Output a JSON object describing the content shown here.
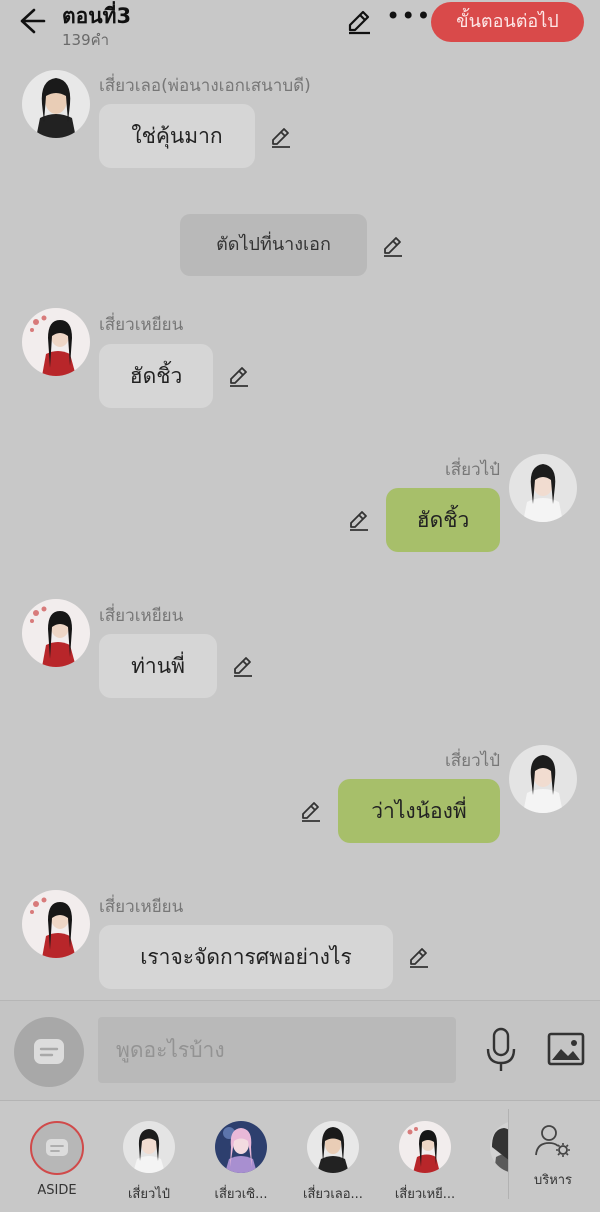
{
  "header": {
    "title": "ตอนที่3",
    "word_count": "139คำ",
    "next_step_label": "ขั้นตอนต่อไป",
    "accent_color": "#d94a4a"
  },
  "messages": [
    {
      "type": "left",
      "sender": "เสี่ยวเลอ(พ่อนางเอกเสนาบดี)",
      "text": "ใช่คุ้นมาก",
      "avatar": "male-black-robe"
    },
    {
      "type": "narration",
      "text": "ตัดไปที่นางเอก"
    },
    {
      "type": "left",
      "sender": "เสี่ยวเหยียน",
      "text": "ฮัดชิ้ว",
      "avatar": "female-red-dress"
    },
    {
      "type": "right",
      "sender": "เสี่ยวไป๋",
      "text": "ฮัดชิ้ว",
      "avatar": "female-white-dress"
    },
    {
      "type": "left",
      "sender": "เสี่ยวเหยียน",
      "text": "ท่านพี่",
      "avatar": "female-red-dress"
    },
    {
      "type": "right",
      "sender": "เสี่ยวไป๋",
      "text": "ว่าไงน้องพี่",
      "avatar": "female-white-dress"
    },
    {
      "type": "left",
      "sender": "เสี่ยวเหยียน",
      "text": "เราจะจัดการศพอย่างไร",
      "avatar": "female-red-dress"
    }
  ],
  "input": {
    "placeholder": "พูดอะไรบ้าง"
  },
  "characters": [
    {
      "name": "ASIDE"
    },
    {
      "name": "เสี่ยวไป๋"
    },
    {
      "name": "เสี่ยวเซิ..."
    },
    {
      "name": "เสี่ยวเลอ..."
    },
    {
      "name": "เสี่ยวเหยี..."
    },
    {
      "name": ""
    }
  ],
  "manage_label": "บริหาร"
}
